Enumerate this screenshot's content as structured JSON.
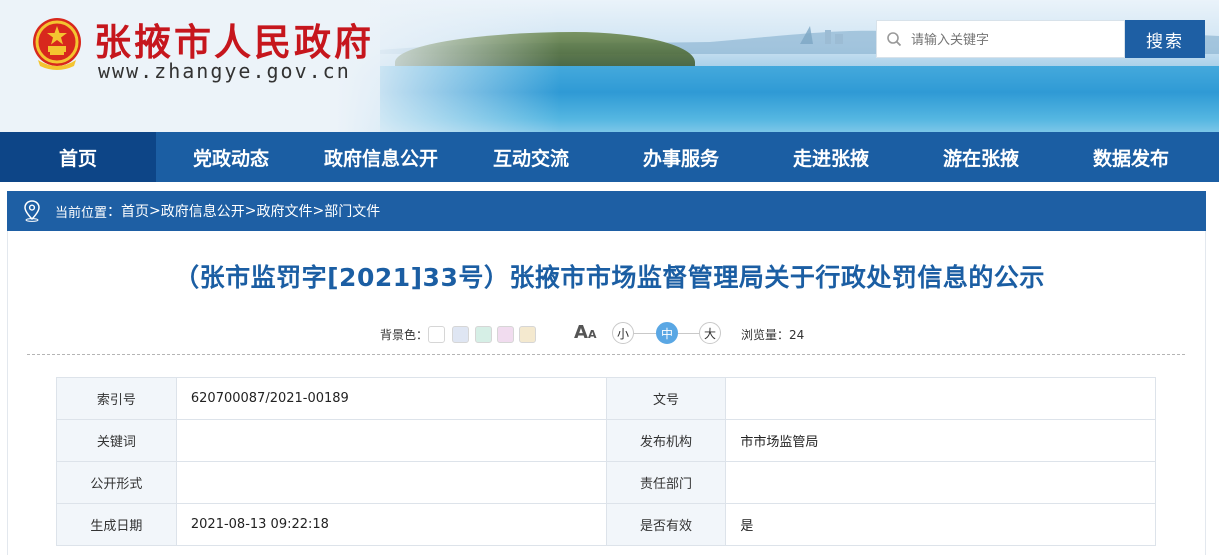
{
  "header": {
    "site_title": "张掖市人民政府",
    "site_url": "www.zhangye.gov.cn",
    "search_placeholder": "请输入关键字",
    "search_button": "搜索"
  },
  "nav": {
    "items": [
      "首页",
      "党政动态",
      "政府信息公开",
      "互动交流",
      "办事服务",
      "走进张掖",
      "游在张掖",
      "数据发布"
    ]
  },
  "breadcrumb": {
    "label": "当前位置",
    "colon": "：",
    "links": [
      "首页",
      "政府信息公开",
      "政府文件",
      "部门文件"
    ],
    "separator": ">"
  },
  "article": {
    "title": "（张市监罚字[2021]33号）张掖市市场监督管理局关于行政处罚信息的公示",
    "background_label": "背景色：",
    "background_colors": [
      "#ffffff",
      "#dfe6f3",
      "#d6efe6",
      "#f1dcef",
      "#f4e9cf"
    ],
    "font_sizes": [
      "小",
      "中",
      "大"
    ],
    "font_size_selected": "中",
    "views_label": "浏览量：",
    "views": "24"
  },
  "info_table": {
    "rows": [
      {
        "k1": "索引号",
        "v1": "620700087/2021-00189",
        "k2": "文号",
        "v2": ""
      },
      {
        "k1": "关键词",
        "v1": "",
        "k2": "发布机构",
        "v2": "市市场监管局"
      },
      {
        "k1": "公开形式",
        "v1": "",
        "k2": "责任部门",
        "v2": ""
      },
      {
        "k1": "生成日期",
        "v1": "2021-08-13 09:22:18",
        "k2": "是否有效",
        "v2": "是"
      }
    ]
  },
  "colors": {
    "title_red": "#c6161d",
    "nav_blue": "#1b5ea3",
    "nav_active": "#0d4587",
    "title_blue": "#1b5ea3"
  }
}
